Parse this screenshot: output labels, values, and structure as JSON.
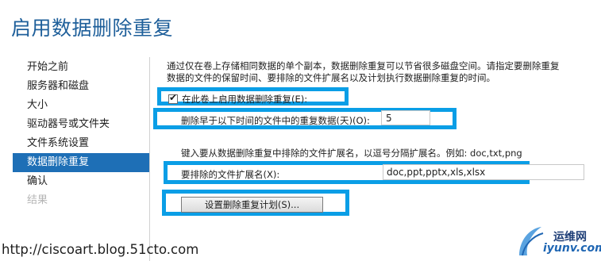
{
  "title": "启用数据删除重复",
  "nav": {
    "items": [
      {
        "label": "开始之前"
      },
      {
        "label": "服务器和磁盘"
      },
      {
        "label": "大小"
      },
      {
        "label": "驱动器号或文件夹"
      },
      {
        "label": "文件系统设置"
      },
      {
        "label": "数据删除重复",
        "active": true
      },
      {
        "label": "确认"
      },
      {
        "label": "结果",
        "disabled": true
      }
    ]
  },
  "main": {
    "description_line1": "通过仅在卷上存储相同数据的单个副本，数据删除重复可以节省很多磁盘空间。请指定要删除重复",
    "description_line2": "数据的文件的保留时间、要排除的文件扩展名以及计划执行数据删除重复的时间。",
    "enable_checkbox": {
      "label": "在此卷上启用数据删除重复(E):",
      "checked": true,
      "check_glyph": "✔"
    },
    "days_label": "删除早于以下时间的文件中的重复数据(天)(O):",
    "days_value": "5",
    "exclude_hint": "键入要从数据删除重复中排除的文件扩展名，以逗号分隔扩展名。例如: doc,txt,png",
    "exclude_label": "要排除的文件扩展名(X):",
    "exclude_value": "doc,ppt,pptx,xls,xlsx",
    "schedule_button": "设置删除重复计划(S)..."
  },
  "watermark": "http://ciscoart.blog.51cto.com",
  "logo": {
    "cn": "运维网",
    "en": "iyunv.com"
  },
  "colors": {
    "title": "#1e5f9a",
    "nav_active": "#1e6fb6",
    "highlight": "#0a9ee6"
  }
}
